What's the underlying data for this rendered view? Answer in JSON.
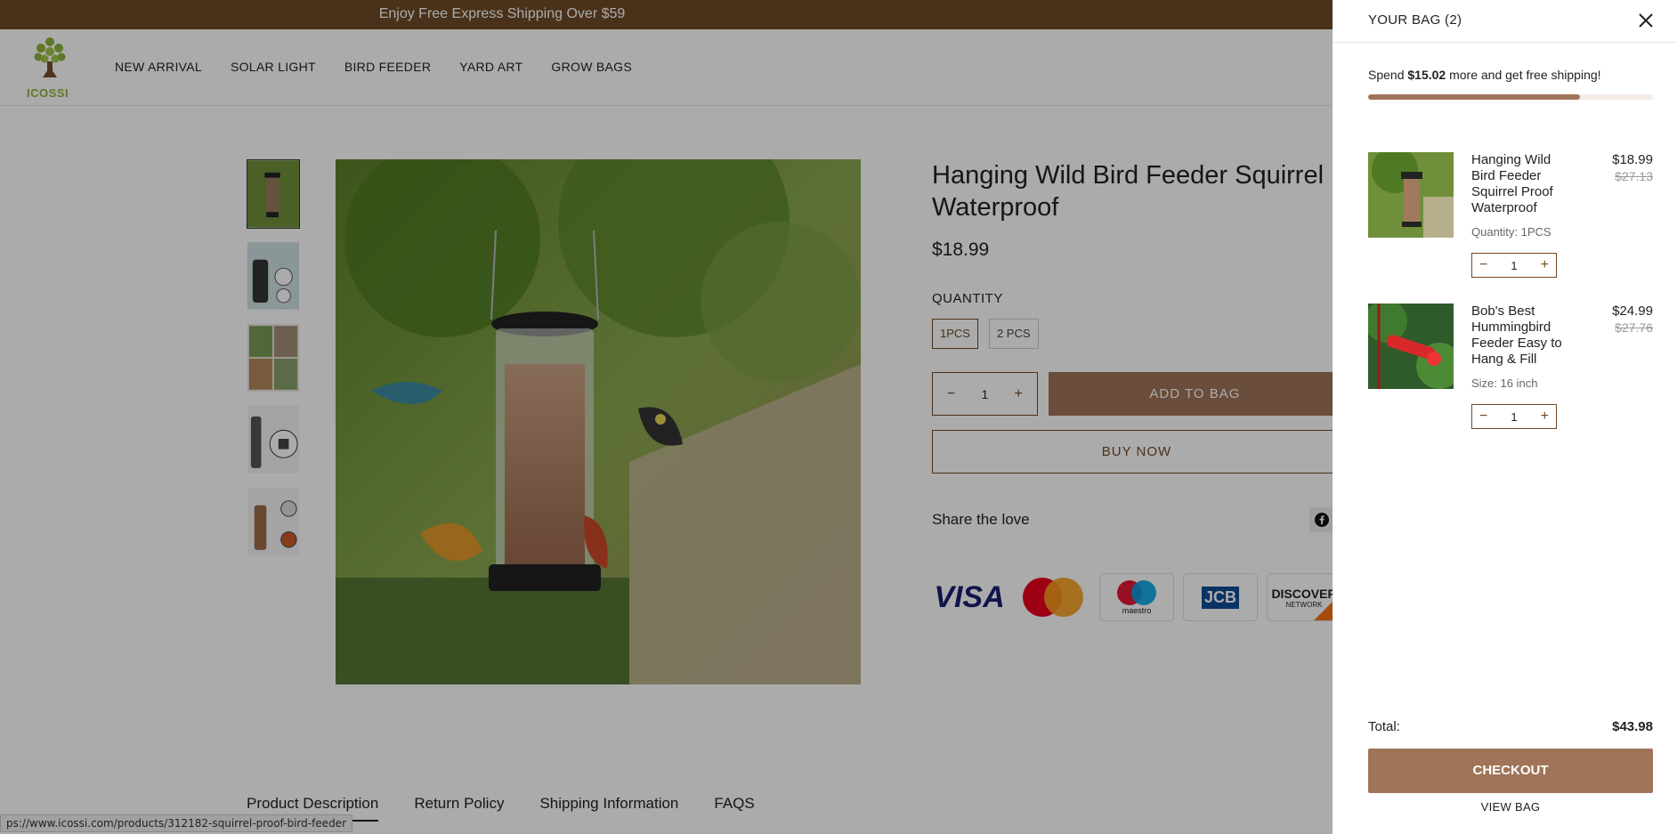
{
  "announcement": "Enjoy Free Express Shipping Over $59",
  "brand": "ICOSSI",
  "nav": [
    "NEW ARRIVAL",
    "SOLAR LIGHT",
    "BIRD FEEDER",
    "YARD ART",
    "GROW BAGS"
  ],
  "product": {
    "title": "Hanging Wild Bird Feeder Squirrel Proof Waterproof",
    "price": "$18.99",
    "quantity_label": "QUANTITY",
    "variants": [
      "1PCS",
      "2 PCS"
    ],
    "selected_variant": "1PCS",
    "qty": "1",
    "add_to_bag": "ADD TO BAG",
    "buy_now": "BUY NOW",
    "share": "Share the love"
  },
  "payments": {
    "visa": "VISA",
    "maestro": "maestro",
    "jcb": "JCB",
    "discover": "DISCOVER",
    "discover_sub": "NETWORK"
  },
  "tabs": [
    "Product Description",
    "Return Policy",
    "Shipping Information",
    "FAQS"
  ],
  "status_url": "ps://www.icossi.com/products/312182-squirrel-proof-bird-feeder",
  "cart": {
    "title": "YOUR BAG (2)",
    "shipping_prefix": "Spend ",
    "shipping_amount": "$15.02",
    "shipping_suffix": " more and get free shipping!",
    "shipping_progress": 0.745,
    "items": [
      {
        "name": "Hanging Wild Bird Feeder Squirrel Proof Waterproof",
        "option": "Quantity: 1PCS",
        "price": "$18.99",
        "was": "$27.13",
        "qty": "1"
      },
      {
        "name": "Bob's Best Hummingbird Feeder Easy to Hang & Fill",
        "option": "Size: 16 inch",
        "price": "$24.99",
        "was": "$27.76",
        "qty": "1"
      }
    ],
    "total_label": "Total:",
    "total_value": "$43.98",
    "checkout": "CHECKOUT",
    "view_bag": "VIEW BAG"
  }
}
